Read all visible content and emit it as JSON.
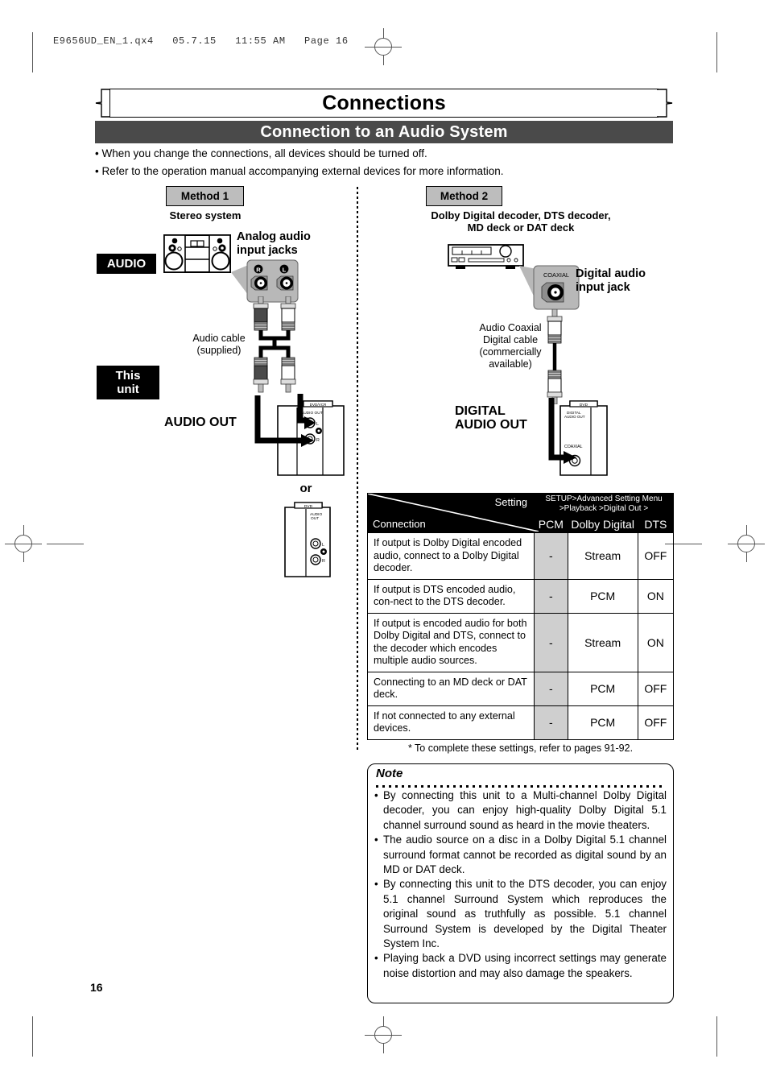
{
  "print_header": "E9656UD_EN_1.qx4   05.7.15   11:55 AM   Page 16",
  "chapter_title": "Connections",
  "section_title": "Connection to an Audio System",
  "intro_bullets": [
    "• When you change the connections, all devices should be turned off.",
    "• Refer to the operation manual accompanying external devices for more information."
  ],
  "method1": {
    "chip": "Method 1",
    "device_title": "Stereo system",
    "source_tag": "AUDIO",
    "unit_tag": "This unit",
    "jacks_label": "Analog audio\ninput jacks",
    "jack_r": "R",
    "jack_l": "L",
    "cable_label": "Audio cable\n(supplied)",
    "out_label": "AUDIO OUT",
    "or_label": "or",
    "panel1": {
      "model": "DVD/VCR",
      "group": "AUDIO OUT",
      "jack_l": "L",
      "jack_r": "R"
    },
    "panel2": {
      "model": "DVD",
      "group": "AUDIO OUT",
      "jack_l": "L",
      "jack_r": "R"
    }
  },
  "method2": {
    "chip": "Method 2",
    "device_title": "Dolby Digital decoder, DTS decoder,\nMD deck or DAT deck",
    "jack_label": "Digital audio\ninput jack",
    "jack_name": "COAXIAL",
    "cable_label": "Audio Coaxial\nDigital cable\n(commercially\navailable)",
    "out_label": "DIGITAL\nAUDIO OUT",
    "panel": {
      "model": "DVD",
      "group": "DIGITAL\nAUDIO OUT",
      "jack": "COAXIAL"
    }
  },
  "table": {
    "corner_setting": "Setting",
    "corner_connection": "Connection",
    "menu_path": "SETUP>Advanced Setting Menu\n>Playback >Digital Out >",
    "columns": [
      "PCM",
      "Dolby Digital",
      "DTS"
    ],
    "rows": [
      {
        "connection": "If output is Dolby Digital encoded audio, connect to a Dolby Digital decoder.",
        "pcm": "-",
        "dolby_digital": "Stream",
        "dts": "OFF"
      },
      {
        "connection": "If output is DTS encoded audio, con-nect to the DTS decoder.",
        "pcm": "-",
        "dolby_digital": "PCM",
        "dts": "ON"
      },
      {
        "connection": "If output is encoded audio for both Dolby Digital and DTS, connect to the decoder which encodes multiple audio sources.",
        "pcm": "-",
        "dolby_digital": "Stream",
        "dts": "ON"
      },
      {
        "connection": "Connecting to an MD deck or DAT deck.",
        "pcm": "-",
        "dolby_digital": "PCM",
        "dts": "OFF"
      },
      {
        "connection": "If not connected to any external devices.",
        "pcm": "-",
        "dolby_digital": "PCM",
        "dts": "OFF"
      }
    ],
    "footnote": "* To complete these settings, refer to pages 91-92."
  },
  "note": {
    "title": "Note",
    "items": [
      "By connecting this unit to a Multi-channel Dolby Digital decoder, you can enjoy high-quality Dolby Digital 5.1 channel surround sound as heard in the movie theaters.",
      "The audio source on a disc in a Dolby Digital 5.1 channel surround format cannot be recorded as digital sound by an MD or DAT deck.",
      "By connecting this unit to the DTS decoder, you can enjoy 5.1 channel Surround System which reproduces the original sound as truthfully as possible. 5.1 channel Surround System is developed by the Digital Theater System Inc.",
      "Playing back a DVD using incorrect settings may generate noise distortion and may also damage the speakers."
    ]
  },
  "page_number": "16"
}
